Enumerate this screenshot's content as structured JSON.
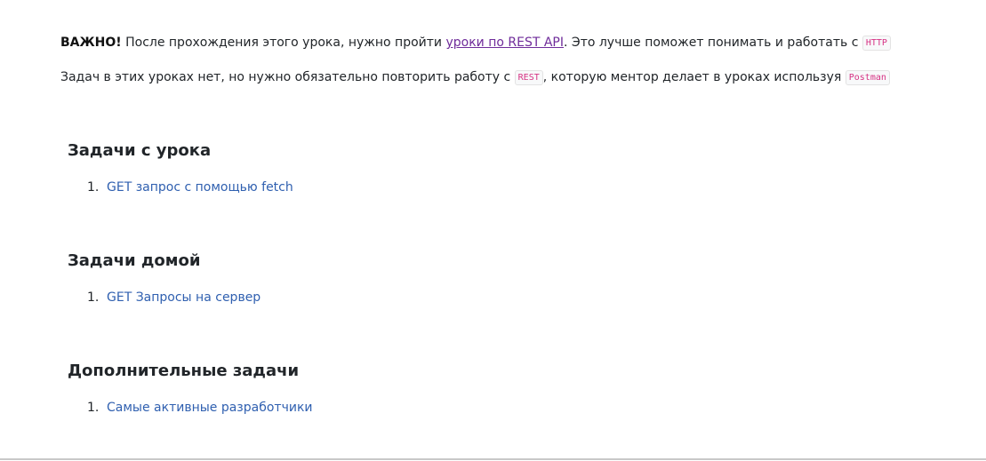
{
  "intro": {
    "important_label": "ВАЖНО!",
    "p1_text_before_link": " После прохождения этого урока, нужно пройти ",
    "p1_link_text": "уроки по REST API",
    "p1_text_after_link": ". Это лучше поможет понимать и работать с ",
    "p1_code": "HTTP",
    "p2_text_before_code": "Задач в этих уроках нет, но нужно обязательно повторить работу с ",
    "p2_code_rest": "REST",
    "p2_text_middle": ", которую ментор делает в уроках используя ",
    "p2_code_postman": "Postman"
  },
  "sections": [
    {
      "title": "Задачи с урока",
      "items": [
        {
          "number": "1.",
          "label": "GET запрос с помощью fetch"
        }
      ]
    },
    {
      "title": "Задачи домой",
      "items": [
        {
          "number": "1.",
          "label": "GET Запросы на сервер"
        }
      ]
    },
    {
      "title": "Дополнительные задачи",
      "items": [
        {
          "number": "1.",
          "label": "Самые активные разработчики"
        }
      ]
    }
  ],
  "colors": {
    "text": "#212529",
    "task_link": "#3060b0",
    "visited_link": "#6f2c9a",
    "code_text": "#d63384"
  }
}
